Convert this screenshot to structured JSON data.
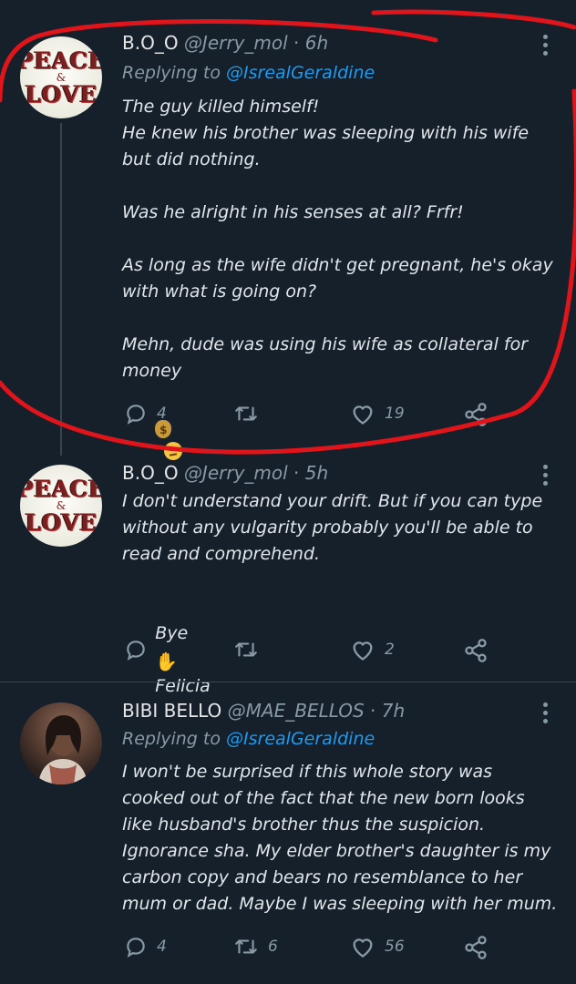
{
  "tweets": [
    {
      "author": "B.O_O",
      "handle": "@Jerry_mol",
      "time": "6h",
      "replying_label": "Replying to",
      "replying_to": "@IsrealGeraldine",
      "avatar_lines": [
        "PEACE",
        "&",
        "LOVE"
      ],
      "paragraphs": [
        "The guy killed himself!\nHe knew his brother was sleeping with his wife but did nothing.",
        "Was he alright in his senses at all? Frfr!",
        "As long as the wife didn't get pregnant, he's okay with what is going on?",
        "Mehn, dude was using his wife as collateral for money"
      ],
      "emojis": [
        "money-bag",
        "confused-face"
      ],
      "reply_count": "4",
      "retweet_count": "",
      "like_count": "19"
    },
    {
      "author": "B.O_O",
      "handle": "@Jerry_mol",
      "time": "5h",
      "avatar_lines": [
        "PEACE",
        "&",
        "LOVE"
      ],
      "paragraphs": [
        "I don't understand your drift. But if you can type without any vulgarity probably you'll be able to read and comprehend.",
        "Bye",
        "Felicia"
      ],
      "emojis": [
        "waving-hand"
      ],
      "reply_count": "",
      "retweet_count": "",
      "like_count": "2"
    },
    {
      "author": "BIBI BELLO",
      "handle": "@MAE_BELLOS",
      "time": "7h",
      "replying_label": "Replying to",
      "replying_to": "@IsrealGeraldine",
      "paragraphs": [
        "I won't be surprised if this whole story was cooked out of the fact that the new born looks like husband's brother thus the suspicion. Ignorance sha. My elder brother's daughter is my carbon copy and bears no resemblance to her mum or dad. Maybe I was sleeping with her mum."
      ],
      "reply_count": "4",
      "retweet_count": "6",
      "like_count": "56"
    }
  ],
  "colors": {
    "background": "#15202b",
    "handle": "#8899a6",
    "mention": "#1d9bf0",
    "annotation": "#e0151b"
  },
  "icons": [
    "reply-icon",
    "retweet-icon",
    "like-icon",
    "share-icon",
    "more-icon"
  ]
}
